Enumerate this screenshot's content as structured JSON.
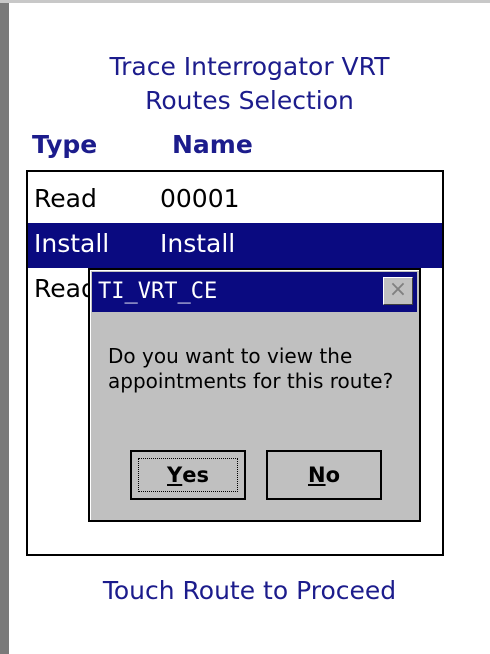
{
  "title": {
    "line1": "Trace Interrogator VRT",
    "line2": "Routes Selection"
  },
  "columns": {
    "type": "Type",
    "name": "Name"
  },
  "routes": [
    {
      "type": "Read",
      "name": "00001",
      "selected": false
    },
    {
      "type": "Install",
      "name": "Install",
      "selected": true
    },
    {
      "type": "Read",
      "name": "",
      "selected": false
    }
  ],
  "footer": "Touch Route to Proceed",
  "dialog": {
    "title": "TI_VRT_CE",
    "close_glyph": "×",
    "message": "Do you want to view the appointments for this route?",
    "yes_label_first": "Y",
    "yes_label_rest": "es",
    "no_label_first": "N",
    "no_label_rest": "o"
  },
  "colors": {
    "accent": "#1c1c8c",
    "selection": "#0a0a80",
    "dialog_bg": "#c0c0c0"
  }
}
